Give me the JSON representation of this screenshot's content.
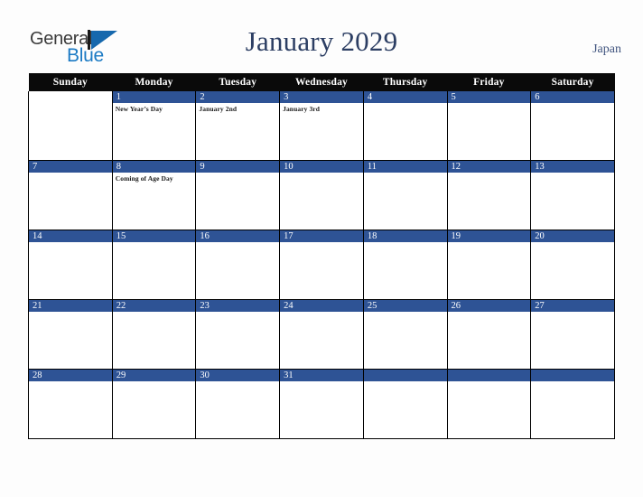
{
  "logo": {
    "word1": "General",
    "word2": "Blue",
    "triangle_color": "#1668ad",
    "word2_color": "#1b7ac4"
  },
  "header": {
    "title": "January 2029",
    "country": "Japan",
    "title_color": "#2c3e63"
  },
  "calendar": {
    "weekday_headers": [
      "Sunday",
      "Monday",
      "Tuesday",
      "Wednesday",
      "Thursday",
      "Friday",
      "Saturday"
    ],
    "header_bg": "#0a0a0a",
    "daynum_bg": "#2e5395",
    "weeks": [
      [
        {
          "day": "",
          "event": "",
          "filled": false
        },
        {
          "day": "1",
          "event": "New Year’s Day",
          "filled": true
        },
        {
          "day": "2",
          "event": "January 2nd",
          "filled": true
        },
        {
          "day": "3",
          "event": "January 3rd",
          "filled": true
        },
        {
          "day": "4",
          "event": "",
          "filled": true
        },
        {
          "day": "5",
          "event": "",
          "filled": true
        },
        {
          "day": "6",
          "event": "",
          "filled": true
        }
      ],
      [
        {
          "day": "7",
          "event": "",
          "filled": true
        },
        {
          "day": "8",
          "event": "Coming of Age Day",
          "filled": true
        },
        {
          "day": "9",
          "event": "",
          "filled": true
        },
        {
          "day": "10",
          "event": "",
          "filled": true
        },
        {
          "day": "11",
          "event": "",
          "filled": true
        },
        {
          "day": "12",
          "event": "",
          "filled": true
        },
        {
          "day": "13",
          "event": "",
          "filled": true
        }
      ],
      [
        {
          "day": "14",
          "event": "",
          "filled": true
        },
        {
          "day": "15",
          "event": "",
          "filled": true
        },
        {
          "day": "16",
          "event": "",
          "filled": true
        },
        {
          "day": "17",
          "event": "",
          "filled": true
        },
        {
          "day": "18",
          "event": "",
          "filled": true
        },
        {
          "day": "19",
          "event": "",
          "filled": true
        },
        {
          "day": "20",
          "event": "",
          "filled": true
        }
      ],
      [
        {
          "day": "21",
          "event": "",
          "filled": true
        },
        {
          "day": "22",
          "event": "",
          "filled": true
        },
        {
          "day": "23",
          "event": "",
          "filled": true
        },
        {
          "day": "24",
          "event": "",
          "filled": true
        },
        {
          "day": "25",
          "event": "",
          "filled": true
        },
        {
          "day": "26",
          "event": "",
          "filled": true
        },
        {
          "day": "27",
          "event": "",
          "filled": true
        }
      ],
      [
        {
          "day": "28",
          "event": "",
          "filled": true
        },
        {
          "day": "29",
          "event": "",
          "filled": true
        },
        {
          "day": "30",
          "event": "",
          "filled": true
        },
        {
          "day": "31",
          "event": "",
          "filled": true
        },
        {
          "day": "",
          "event": "",
          "filled": true
        },
        {
          "day": "",
          "event": "",
          "filled": true
        },
        {
          "day": "",
          "event": "",
          "filled": true
        }
      ]
    ]
  }
}
